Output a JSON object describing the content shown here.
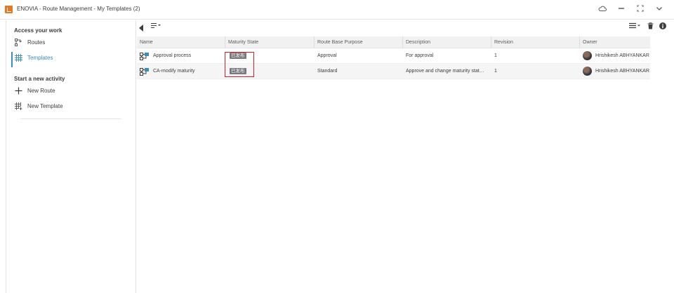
{
  "window": {
    "title": "ENOVIA - Route Management - My Templates (2)",
    "controls": [
      "cloud-icon",
      "minimize-icon",
      "fullscreen-icon",
      "chevron-down-icon"
    ]
  },
  "sidebar": {
    "access_heading": "Access your work",
    "items": [
      {
        "label": "Routes",
        "icon": "routes-icon"
      },
      {
        "label": "Templates",
        "icon": "templates-grid-icon"
      }
    ],
    "activity_heading": "Start a new activity",
    "actions": [
      {
        "label": "New Route",
        "icon": "plus-icon"
      },
      {
        "label": "New Template",
        "icon": "new-template-icon"
      }
    ]
  },
  "colors": {
    "accent": "#368ec4",
    "brand": "#e87722",
    "highlight": "#d4202a",
    "badge": "#77797c"
  },
  "table": {
    "columns": [
      "Name",
      "Maturity State",
      "Route Base Purpose",
      "Description",
      "Revision",
      "Owner"
    ],
    "rows": [
      {
        "name": "Approval process",
        "state": "已发布",
        "purpose": "Approval",
        "description": "For approval",
        "revision": "1",
        "owner": "Hrishikesh ABHYANKAR"
      },
      {
        "name": "CA-modify maturity",
        "state": "已发布",
        "purpose": "Standard",
        "description": "Approve and change maturity stat…",
        "revision": "1",
        "owner": "Hrishikesh ABHYANKAR"
      }
    ]
  }
}
